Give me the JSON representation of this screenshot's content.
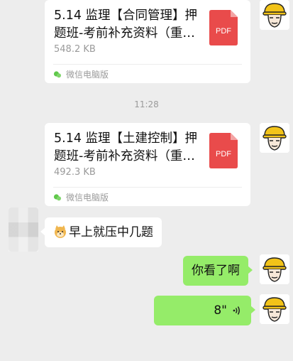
{
  "messages": {
    "file1": {
      "title": "5.14 监理【合同管理】押题班-考前补充资料（重…",
      "size": "548.2 KB",
      "source": "微信电脑版",
      "badge": "PDF"
    },
    "timestamp": "11:28",
    "file2": {
      "title": "5.14 监理【土建控制】押题班-考前补充资料（重…",
      "size": "492.3 KB",
      "source": "微信电脑版",
      "badge": "PDF"
    },
    "incoming_text": "早上就压中几题",
    "outgoing_text": "你看了啊",
    "voice_duration": "8\""
  },
  "colors": {
    "background": "#ededed",
    "outgoing_bubble": "#95ec69",
    "incoming_bubble": "#ffffff",
    "pdf_red": "#e94b4b",
    "meta_gray": "#9a9a9a"
  },
  "icons": {
    "avatar": "hardhat-worker-avatar",
    "file_type": "pdf-file-icon",
    "source": "wechat-icon",
    "emoji": "doge-emoji",
    "voice": "voice-wave-icon"
  }
}
